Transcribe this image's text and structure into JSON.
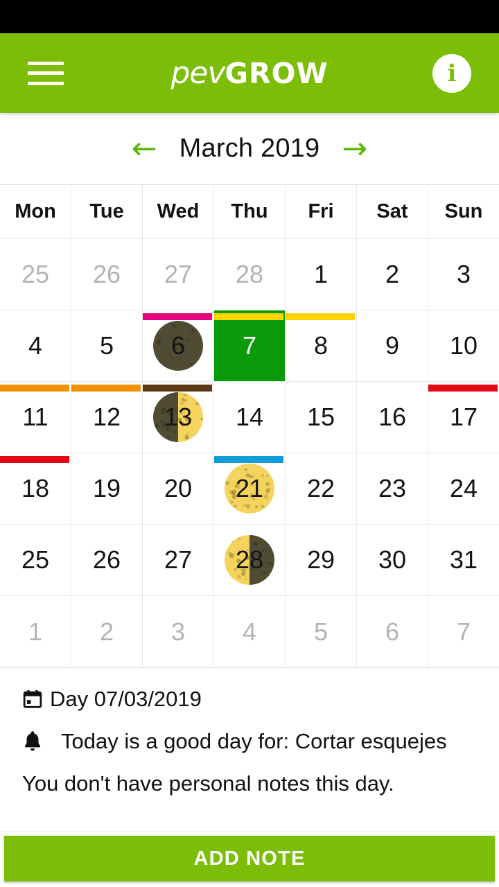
{
  "app": {
    "brand_lower": "pev",
    "brand_upper": "GROW",
    "menu_icon": "hamburger-menu-icon",
    "info_icon": "info-icon",
    "info_label": "i"
  },
  "month_nav": {
    "prev_label": "←",
    "next_label": "→",
    "title": "March 2019"
  },
  "calendar": {
    "weekdays": [
      "Mon",
      "Tue",
      "Wed",
      "Thu",
      "Fri",
      "Sat",
      "Sun"
    ],
    "weeks": [
      [
        {
          "day": "25",
          "other": true
        },
        {
          "day": "26",
          "other": true
        },
        {
          "day": "27",
          "other": true
        },
        {
          "day": "28",
          "other": true
        },
        {
          "day": "1"
        },
        {
          "day": "2"
        },
        {
          "day": "3"
        }
      ],
      [
        {
          "day": "4"
        },
        {
          "day": "5"
        },
        {
          "day": "6",
          "bar": "#e6007e",
          "moon": "new"
        },
        {
          "day": "7",
          "bar": "#ffd400",
          "selected": true
        },
        {
          "day": "8",
          "bar": "#ffd400"
        },
        {
          "day": "9"
        },
        {
          "day": "10"
        }
      ],
      [
        {
          "day": "11",
          "bar": "#f29100"
        },
        {
          "day": "12",
          "bar": "#f29100"
        },
        {
          "day": "13",
          "bar": "#5c3a17",
          "moon": "first-quarter"
        },
        {
          "day": "14"
        },
        {
          "day": "15"
        },
        {
          "day": "16"
        },
        {
          "day": "17",
          "bar": "#e30613"
        }
      ],
      [
        {
          "day": "18",
          "bar": "#e30613"
        },
        {
          "day": "19"
        },
        {
          "day": "20"
        },
        {
          "day": "21",
          "bar": "#0e9dd9",
          "moon": "full"
        },
        {
          "day": "22"
        },
        {
          "day": "23"
        },
        {
          "day": "24"
        }
      ],
      [
        {
          "day": "25"
        },
        {
          "day": "26"
        },
        {
          "day": "27"
        },
        {
          "day": "28",
          "moon": "last-quarter"
        },
        {
          "day": "29"
        },
        {
          "day": "30"
        },
        {
          "day": "31"
        }
      ],
      [
        {
          "day": "1",
          "other": true
        },
        {
          "day": "2",
          "other": true
        },
        {
          "day": "3",
          "other": true
        },
        {
          "day": "4",
          "other": true
        },
        {
          "day": "5",
          "other": true
        },
        {
          "day": "6",
          "other": true
        },
        {
          "day": "7",
          "other": true
        }
      ]
    ]
  },
  "info": {
    "date_icon": "calendar-icon",
    "date_text": "Day 07/03/2019",
    "tip_icon": "bell-icon",
    "tip_text": "Today is a good day for: Cortar esquejes",
    "notes_text": "You don't have personal notes this day."
  },
  "footer": {
    "add_note_label": "ADD NOTE"
  },
  "colors": {
    "brand_green": "#7cbe07",
    "selected_green": "#089a08",
    "arrow_green": "#5fb709",
    "bar_magenta": "#e6007e",
    "bar_yellow": "#ffd400",
    "bar_orange": "#f29100",
    "bar_brown": "#5c3a17",
    "bar_red": "#e30613",
    "bar_blue": "#0e9dd9",
    "moon_dark": "#504b33",
    "moon_light": "#f4d45e"
  }
}
